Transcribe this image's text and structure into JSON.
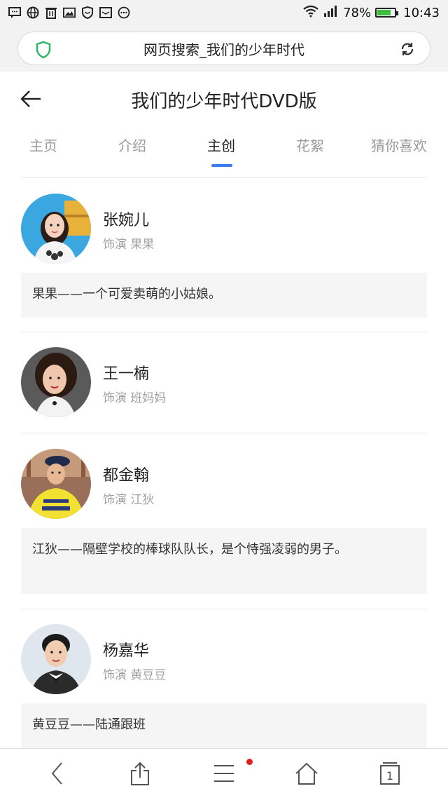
{
  "status_bar": {
    "battery_percent": "78%",
    "time": "10:43",
    "battery_level": 0.78,
    "icons": [
      "message-icon",
      "globe-icon",
      "trash-icon",
      "image-icon",
      "shield-icon",
      "mail-icon",
      "more-dots-icon"
    ]
  },
  "browser": {
    "url_text": "网页搜索_我们的少年时代"
  },
  "page": {
    "title": "我们的少年时代DVD版"
  },
  "tabs": [
    {
      "label": "主页"
    },
    {
      "label": "介绍"
    },
    {
      "label": "主创"
    },
    {
      "label": "花絮"
    },
    {
      "label": "猜你喜欢"
    }
  ],
  "active_tab": "主创",
  "cast": [
    {
      "name": "张婉儿",
      "role": "饰演 果果",
      "description": "果果——一个可爱卖萌的小姑娘。"
    },
    {
      "name": "王一楠",
      "role": "饰演 班妈妈",
      "description": ""
    },
    {
      "name": "都金翰",
      "role": "饰演 江狄",
      "description": "江狄——隔壁学校的棒球队队长，是个恃强凌弱的男子。"
    },
    {
      "name": "杨嘉华",
      "role": "饰演 黄豆豆",
      "description": "黄豆豆——陆通跟班"
    }
  ],
  "bottom_nav": {
    "tab_count": "1",
    "icons": [
      "back-icon",
      "share-icon",
      "menu-icon",
      "home-icon",
      "tabs-icon"
    ]
  },
  "colors": {
    "accent": "#3b7bf0",
    "shield_green": "#2db36a",
    "notify_red": "#e02020",
    "status_bg": "#f1f2f1"
  }
}
